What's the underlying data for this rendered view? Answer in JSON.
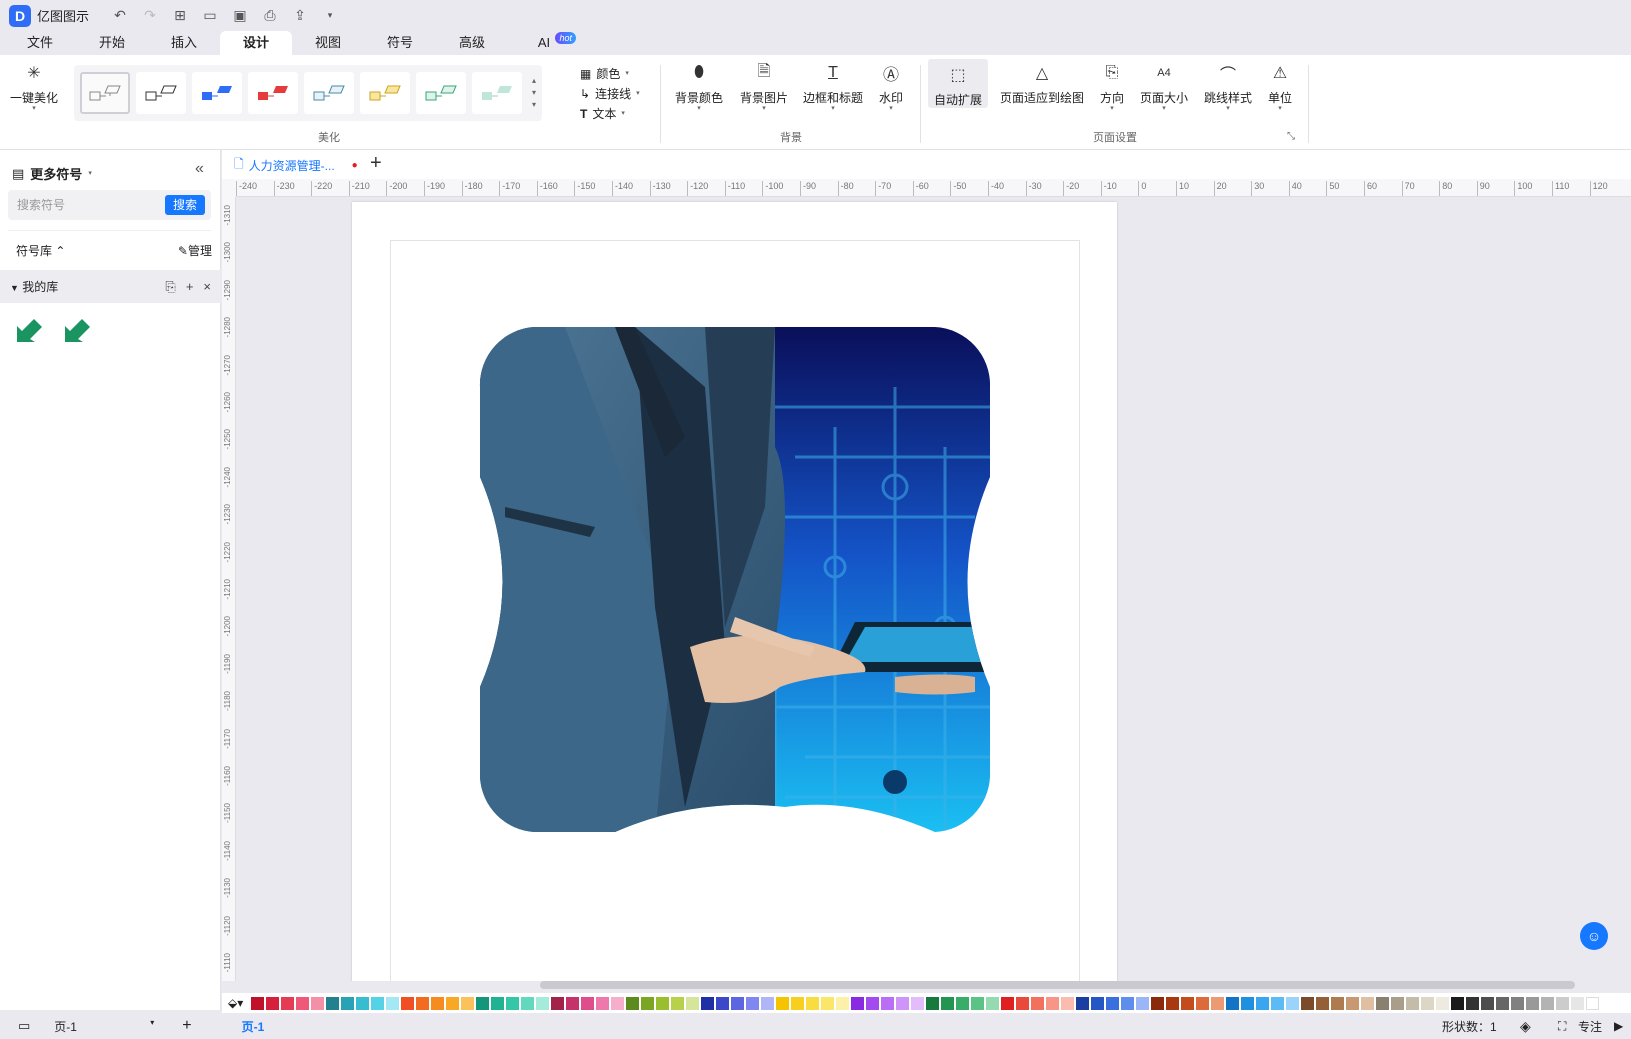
{
  "app": {
    "name": "亿图图示"
  },
  "menu": [
    {
      "label": "文件"
    },
    {
      "label": "开始"
    },
    {
      "label": "插入"
    },
    {
      "label": "设计",
      "active": true
    },
    {
      "label": "视图"
    },
    {
      "label": "符号"
    },
    {
      "label": "高级"
    },
    {
      "label": "AI",
      "badge": "hot"
    }
  ],
  "ribbon": {
    "beautify": {
      "one_click": "一键美化",
      "group": "美化"
    },
    "theme_options": {
      "color": "颜色",
      "connector": "连接线",
      "text": "文本"
    },
    "background": {
      "bg_color": "背景颜色",
      "bg_image": "背景图片",
      "border_title": "边框和标题",
      "watermark": "水印",
      "group": "背景"
    },
    "page_setup": {
      "auto_extend": "自动扩展",
      "fit_page": "页面适应到绘图",
      "orientation": "方向",
      "page_size": "页面大小",
      "jump_style": "跳线样式",
      "unit": "单位",
      "group": "页面设置"
    }
  },
  "sidebar": {
    "title": "更多符号",
    "search_placeholder": "搜索符号",
    "search_button": "搜索",
    "library_label": "符号库",
    "manage_label": "管理",
    "my_library": "我的库"
  },
  "document": {
    "tab_title": "人力资源管理-..."
  },
  "ruler_h": [
    -240,
    -230,
    -220,
    -210,
    -200,
    -190,
    -180,
    -170,
    -160,
    -150,
    -140,
    -130,
    -120,
    -110,
    -100,
    -90,
    -80,
    -70,
    -60,
    -50,
    -40,
    -30,
    -20,
    -10,
    0,
    10,
    20,
    30,
    40,
    50,
    60,
    70,
    80,
    90,
    100,
    110,
    120
  ],
  "ruler_v": [
    -1310,
    -1300,
    -1290,
    -1280,
    -1270,
    -1260,
    -1250,
    -1240,
    -1230,
    -1220,
    -1210,
    -1200,
    -1190,
    -1180,
    -1170,
    -1160,
    -1150,
    -1140,
    -1130,
    -1120,
    -1110
  ],
  "palette": [
    "#c0102a",
    "#d61f3a",
    "#e63b55",
    "#f0587a",
    "#f48fa8",
    "#23808e",
    "#2aa2b5",
    "#38bcd0",
    "#56d2e6",
    "#a3e8f2",
    "#f04e23",
    "#f36b20",
    "#f68c1f",
    "#f9a825",
    "#fbc15a",
    "#14967d",
    "#1fb394",
    "#33c7a8",
    "#62d9bf",
    "#a5ebdc",
    "#a3224a",
    "#c4336a",
    "#de4d8c",
    "#ee77ab",
    "#f6aecd",
    "#5b8a1f",
    "#7ba624",
    "#99be2e",
    "#b7d24a",
    "#d5e59a",
    "#1f2fa6",
    "#3a48c9",
    "#5c66e0",
    "#8087ee",
    "#b0b5f6",
    "#f5c400",
    "#f7d01f",
    "#f9dc3f",
    "#fbe66a",
    "#fdf0a8",
    "#8a2be2",
    "#a24cf0",
    "#b96ef5",
    "#ce94f8",
    "#e2bcfb",
    "#177a3c",
    "#229651",
    "#38ad69",
    "#5cc387",
    "#95dab0",
    "#e02020",
    "#ea4a3c",
    "#f2705e",
    "#f79686",
    "#fbbcb0",
    "#1b3fa0",
    "#2456c6",
    "#3a6fe0",
    "#5f8ded",
    "#9ab6f6",
    "#8b2a0a",
    "#a8380f",
    "#c44c1c",
    "#dc6a3a",
    "#ec9a74",
    "#1373c4",
    "#1f8fe0",
    "#3aa6ef",
    "#5cbaf5",
    "#9ad4fa",
    "#7a4a2a",
    "#946038",
    "#ae7a50",
    "#c89872",
    "#e0bea2",
    "#8a8070",
    "#a89e8a",
    "#c4bca8",
    "#dcd6c6",
    "#eeeadf",
    "#1a1a1a",
    "#333333",
    "#4d4d4d",
    "#666666",
    "#808080",
    "#999999",
    "#b3b3b3",
    "#cccccc",
    "#e6e6e6",
    "#ffffff"
  ],
  "status": {
    "page_selector": "页-1",
    "page_tab": "页-1",
    "shape_count": "形状数：1",
    "focus": "专注"
  }
}
